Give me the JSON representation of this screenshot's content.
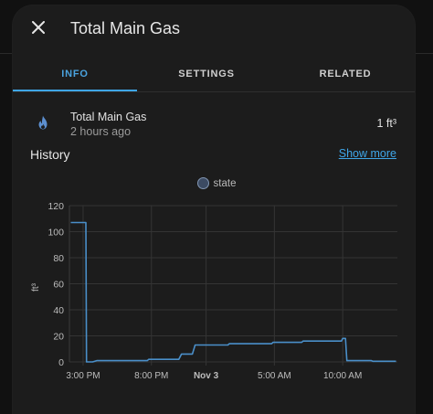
{
  "dialog": {
    "title": "Total Main Gas",
    "close_icon": "close-icon"
  },
  "tabs": [
    {
      "label": "INFO",
      "active": true
    },
    {
      "label": "SETTINGS",
      "active": false
    },
    {
      "label": "RELATED",
      "active": false
    }
  ],
  "entity": {
    "icon": "fire-icon",
    "name": "Total Main Gas",
    "last_changed": "2 hours ago",
    "state": "1 ft³"
  },
  "history": {
    "label": "History",
    "show_more": "Show more"
  },
  "colors": {
    "accent": "#3fa6e8",
    "series": "#4a8fc9",
    "background": "#1c1c1c"
  },
  "chart_data": {
    "type": "line",
    "ylabel": "ft³",
    "ylim": [
      0,
      120
    ],
    "y_ticks": [
      0,
      20,
      40,
      60,
      80,
      100,
      120
    ],
    "x_range_hours": [
      -1.0,
      23.0
    ],
    "x_ticks": [
      {
        "label": "3:00 PM",
        "hour": 0
      },
      {
        "label": "8:00 PM",
        "hour": 5
      },
      {
        "label": "Nov 3",
        "hour": 9,
        "bold": true
      },
      {
        "label": "5:00 AM",
        "hour": 14
      },
      {
        "label": "10:00 AM",
        "hour": 19
      }
    ],
    "legend": [
      "state"
    ],
    "series": [
      {
        "name": "state",
        "step": true,
        "points": [
          [
            -0.9,
            107
          ],
          [
            0.2,
            107
          ],
          [
            0.25,
            0
          ],
          [
            0.7,
            0
          ],
          [
            1.0,
            1
          ],
          [
            4.7,
            1
          ],
          [
            4.8,
            2
          ],
          [
            7.0,
            2
          ],
          [
            7.2,
            6
          ],
          [
            8.0,
            6
          ],
          [
            8.2,
            13
          ],
          [
            10.6,
            13
          ],
          [
            10.7,
            14
          ],
          [
            13.8,
            14
          ],
          [
            13.9,
            15
          ],
          [
            16.0,
            15
          ],
          [
            16.1,
            16
          ],
          [
            18.9,
            16
          ],
          [
            19.0,
            18
          ],
          [
            19.2,
            18
          ],
          [
            19.3,
            1
          ],
          [
            21.1,
            1
          ],
          [
            21.2,
            0.5
          ],
          [
            22.9,
            0.5
          ]
        ]
      }
    ]
  }
}
